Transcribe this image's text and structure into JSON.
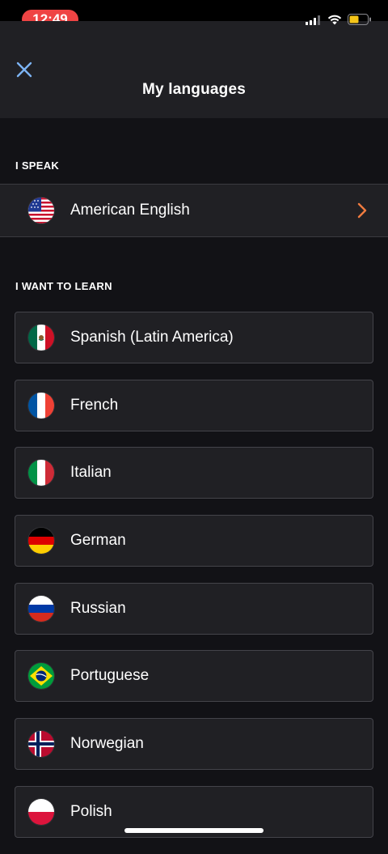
{
  "status_bar": {
    "time": "12:49",
    "signal_icon": "cellular-signal-icon",
    "wifi_icon": "wifi-icon",
    "battery_icon": "battery-low-icon",
    "battery_color": "#f5c518",
    "time_pill_color": "#ef4444"
  },
  "header": {
    "title": "My languages",
    "close_icon": "close-icon",
    "close_color": "#7cb4f5"
  },
  "speak_section": {
    "label": "I SPEAK",
    "language": {
      "name": "American English",
      "flag": "us-flag-icon"
    },
    "chevron_icon": "chevron-right-icon",
    "chevron_color": "#f07b3f"
  },
  "learn_section": {
    "label": "I WANT TO LEARN",
    "languages": [
      {
        "name": "Spanish (Latin America)",
        "flag": "mexico-flag-icon"
      },
      {
        "name": "French",
        "flag": "france-flag-icon"
      },
      {
        "name": "Italian",
        "flag": "italy-flag-icon"
      },
      {
        "name": "German",
        "flag": "germany-flag-icon"
      },
      {
        "name": "Russian",
        "flag": "russia-flag-icon"
      },
      {
        "name": "Portuguese",
        "flag": "brazil-flag-icon"
      },
      {
        "name": "Norwegian",
        "flag": "norway-flag-icon"
      },
      {
        "name": "Polish",
        "flag": "poland-flag-icon"
      }
    ]
  },
  "colors": {
    "background": "#121216",
    "surface": "#202024",
    "card_border": "#44444a"
  }
}
